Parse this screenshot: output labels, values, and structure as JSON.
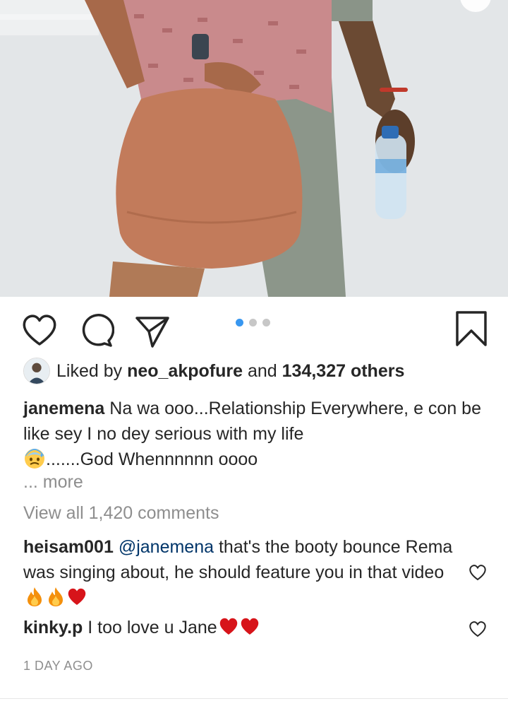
{
  "post": {
    "carousel": {
      "count": 3,
      "active_index": 0
    }
  },
  "actions": {
    "like_icon": "heart-outline-icon",
    "comment_icon": "comment-bubble-icon",
    "share_icon": "paper-plane-icon",
    "save_icon": "bookmark-icon"
  },
  "likes": {
    "prefix": "Liked by",
    "user": "neo_akpofure",
    "joiner": "and",
    "count": "134,327 others"
  },
  "caption": {
    "username": "janemena",
    "text_1": "Na wa ooo...Relationship Everywhere, e con be like sey I no dey serious with my life",
    "text_2": ".......God Whennnnnn oooo",
    "more": "... more"
  },
  "view_all": "View all 1,420 comments",
  "comments": [
    {
      "username": "heisam001",
      "mention": "@janemena",
      "text": "that's the booty bounce Rema was singing about, he should feature you in that video"
    },
    {
      "username": "kinky.p",
      "text": "I too love u Jane"
    }
  ],
  "timestamp": "1 DAY AGO",
  "colors": {
    "accent": "#3897f0",
    "text": "#262626",
    "muted": "#8e8e8e",
    "mention": "#003569",
    "heart_red": "#d7141a"
  }
}
